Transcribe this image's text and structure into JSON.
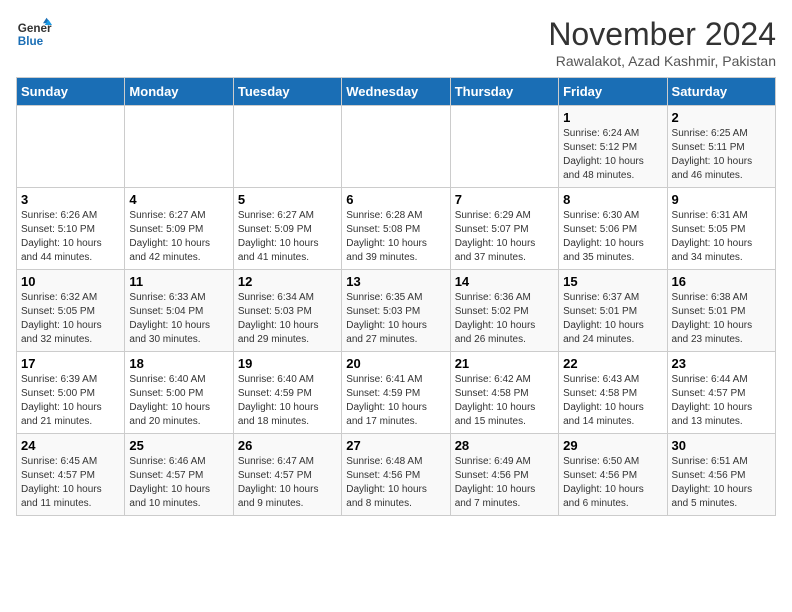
{
  "header": {
    "logo_line1": "General",
    "logo_line2": "Blue",
    "month": "November 2024",
    "location": "Rawalakot, Azad Kashmir, Pakistan"
  },
  "weekdays": [
    "Sunday",
    "Monday",
    "Tuesday",
    "Wednesday",
    "Thursday",
    "Friday",
    "Saturday"
  ],
  "weeks": [
    [
      {
        "day": "",
        "info": ""
      },
      {
        "day": "",
        "info": ""
      },
      {
        "day": "",
        "info": ""
      },
      {
        "day": "",
        "info": ""
      },
      {
        "day": "",
        "info": ""
      },
      {
        "day": "1",
        "info": "Sunrise: 6:24 AM\nSunset: 5:12 PM\nDaylight: 10 hours\nand 48 minutes."
      },
      {
        "day": "2",
        "info": "Sunrise: 6:25 AM\nSunset: 5:11 PM\nDaylight: 10 hours\nand 46 minutes."
      }
    ],
    [
      {
        "day": "3",
        "info": "Sunrise: 6:26 AM\nSunset: 5:10 PM\nDaylight: 10 hours\nand 44 minutes."
      },
      {
        "day": "4",
        "info": "Sunrise: 6:27 AM\nSunset: 5:09 PM\nDaylight: 10 hours\nand 42 minutes."
      },
      {
        "day": "5",
        "info": "Sunrise: 6:27 AM\nSunset: 5:09 PM\nDaylight: 10 hours\nand 41 minutes."
      },
      {
        "day": "6",
        "info": "Sunrise: 6:28 AM\nSunset: 5:08 PM\nDaylight: 10 hours\nand 39 minutes."
      },
      {
        "day": "7",
        "info": "Sunrise: 6:29 AM\nSunset: 5:07 PM\nDaylight: 10 hours\nand 37 minutes."
      },
      {
        "day": "8",
        "info": "Sunrise: 6:30 AM\nSunset: 5:06 PM\nDaylight: 10 hours\nand 35 minutes."
      },
      {
        "day": "9",
        "info": "Sunrise: 6:31 AM\nSunset: 5:05 PM\nDaylight: 10 hours\nand 34 minutes."
      }
    ],
    [
      {
        "day": "10",
        "info": "Sunrise: 6:32 AM\nSunset: 5:05 PM\nDaylight: 10 hours\nand 32 minutes."
      },
      {
        "day": "11",
        "info": "Sunrise: 6:33 AM\nSunset: 5:04 PM\nDaylight: 10 hours\nand 30 minutes."
      },
      {
        "day": "12",
        "info": "Sunrise: 6:34 AM\nSunset: 5:03 PM\nDaylight: 10 hours\nand 29 minutes."
      },
      {
        "day": "13",
        "info": "Sunrise: 6:35 AM\nSunset: 5:03 PM\nDaylight: 10 hours\nand 27 minutes."
      },
      {
        "day": "14",
        "info": "Sunrise: 6:36 AM\nSunset: 5:02 PM\nDaylight: 10 hours\nand 26 minutes."
      },
      {
        "day": "15",
        "info": "Sunrise: 6:37 AM\nSunset: 5:01 PM\nDaylight: 10 hours\nand 24 minutes."
      },
      {
        "day": "16",
        "info": "Sunrise: 6:38 AM\nSunset: 5:01 PM\nDaylight: 10 hours\nand 23 minutes."
      }
    ],
    [
      {
        "day": "17",
        "info": "Sunrise: 6:39 AM\nSunset: 5:00 PM\nDaylight: 10 hours\nand 21 minutes."
      },
      {
        "day": "18",
        "info": "Sunrise: 6:40 AM\nSunset: 5:00 PM\nDaylight: 10 hours\nand 20 minutes."
      },
      {
        "day": "19",
        "info": "Sunrise: 6:40 AM\nSunset: 4:59 PM\nDaylight: 10 hours\nand 18 minutes."
      },
      {
        "day": "20",
        "info": "Sunrise: 6:41 AM\nSunset: 4:59 PM\nDaylight: 10 hours\nand 17 minutes."
      },
      {
        "day": "21",
        "info": "Sunrise: 6:42 AM\nSunset: 4:58 PM\nDaylight: 10 hours\nand 15 minutes."
      },
      {
        "day": "22",
        "info": "Sunrise: 6:43 AM\nSunset: 4:58 PM\nDaylight: 10 hours\nand 14 minutes."
      },
      {
        "day": "23",
        "info": "Sunrise: 6:44 AM\nSunset: 4:57 PM\nDaylight: 10 hours\nand 13 minutes."
      }
    ],
    [
      {
        "day": "24",
        "info": "Sunrise: 6:45 AM\nSunset: 4:57 PM\nDaylight: 10 hours\nand 11 minutes."
      },
      {
        "day": "25",
        "info": "Sunrise: 6:46 AM\nSunset: 4:57 PM\nDaylight: 10 hours\nand 10 minutes."
      },
      {
        "day": "26",
        "info": "Sunrise: 6:47 AM\nSunset: 4:57 PM\nDaylight: 10 hours\nand 9 minutes."
      },
      {
        "day": "27",
        "info": "Sunrise: 6:48 AM\nSunset: 4:56 PM\nDaylight: 10 hours\nand 8 minutes."
      },
      {
        "day": "28",
        "info": "Sunrise: 6:49 AM\nSunset: 4:56 PM\nDaylight: 10 hours\nand 7 minutes."
      },
      {
        "day": "29",
        "info": "Sunrise: 6:50 AM\nSunset: 4:56 PM\nDaylight: 10 hours\nand 6 minutes."
      },
      {
        "day": "30",
        "info": "Sunrise: 6:51 AM\nSunset: 4:56 PM\nDaylight: 10 hours\nand 5 minutes."
      }
    ]
  ]
}
